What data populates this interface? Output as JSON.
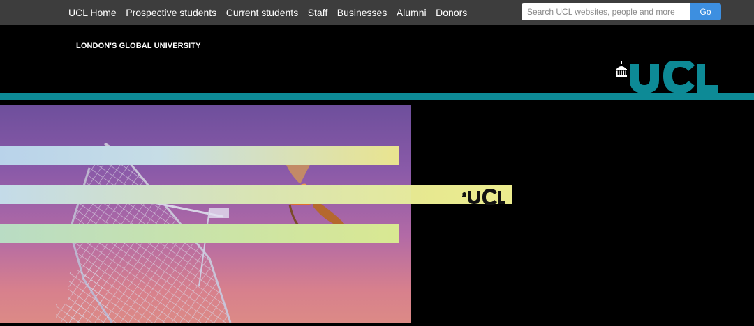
{
  "topnav": {
    "items": [
      {
        "label": "UCL Home"
      },
      {
        "label": "Prospective students"
      },
      {
        "label": "Current students"
      },
      {
        "label": "Staff"
      },
      {
        "label": "Businesses"
      },
      {
        "label": "Alumni"
      },
      {
        "label": "Donors"
      }
    ]
  },
  "search": {
    "placeholder": "Search UCL websites, people and more",
    "value": "",
    "button_label": "Go"
  },
  "header": {
    "tagline": "LONDON'S GLOBAL UNIVERSITY",
    "logo_text": "UCL"
  },
  "hero": {
    "banner_logo_text": "UCL",
    "icons": [
      "radio-telescope",
      "hummingbird"
    ]
  },
  "colors": {
    "topbar_bg": "#3d3d3d",
    "accent_teal": "#0d8a96",
    "go_button": "#3d8fe0",
    "page_bg": "#000000"
  }
}
